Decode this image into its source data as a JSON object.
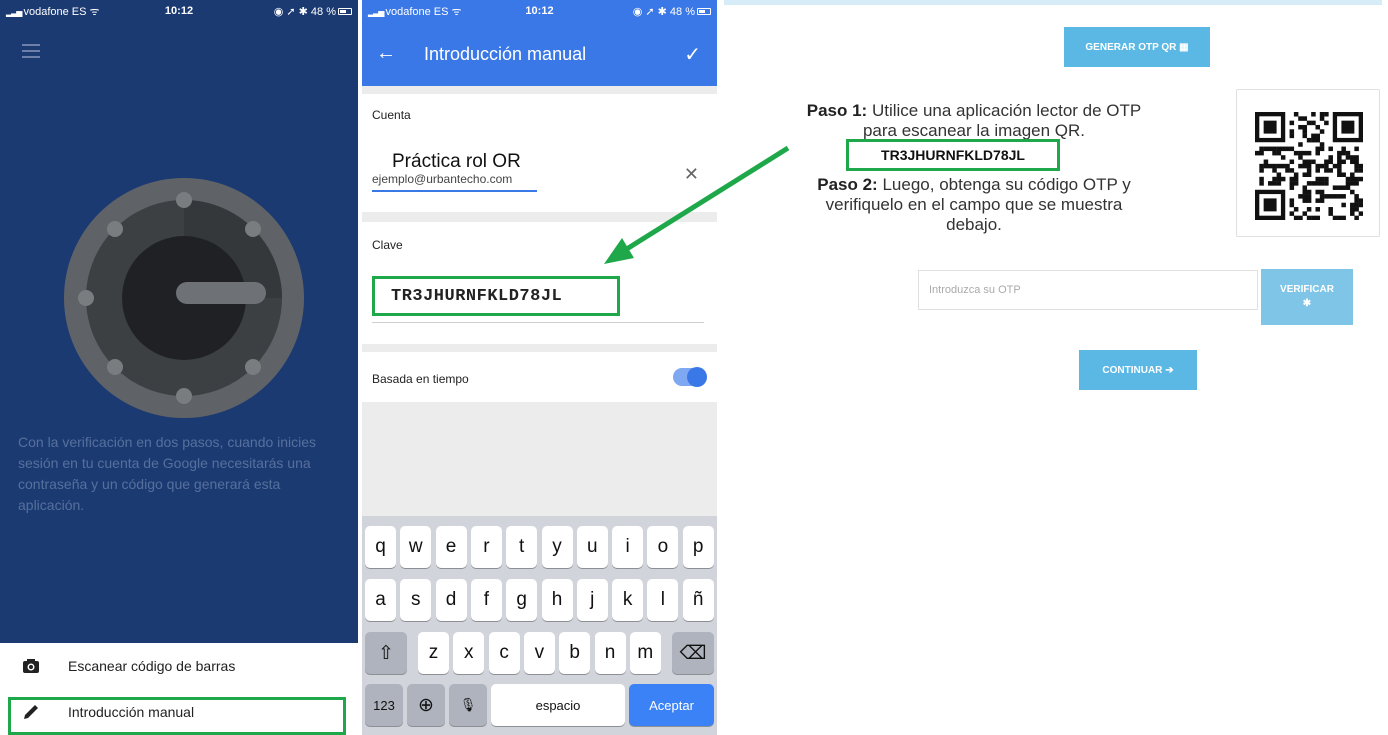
{
  "status_bar": {
    "carrier": "vodafone ES",
    "time": "10:12",
    "battery": "48 %"
  },
  "authenticator": {
    "description": "Con la verificación en dos pasos, cuando inicies sesión en tu cuenta de Google necesitarás una contraseña y un código que generará esta aplicación.",
    "menu": [
      {
        "label": "Escanear código de barras",
        "icon": "camera-icon"
      },
      {
        "label": "Introducción manual",
        "icon": "pencil-icon"
      }
    ]
  },
  "manual_entry": {
    "title": "Introducción manual",
    "account_label": "Cuenta",
    "account_value": "ejemplo@urbantecho.com",
    "account_overlay": "Práctica rol OR",
    "key_label": "Clave",
    "key_value": "TR3JHURNFKLD78JL",
    "time_based_label": "Basada en tiempo",
    "time_based_enabled": true
  },
  "keyboard": {
    "row1": [
      "q",
      "w",
      "e",
      "r",
      "t",
      "y",
      "u",
      "i",
      "o",
      "p"
    ],
    "row2": [
      "a",
      "s",
      "d",
      "f",
      "g",
      "h",
      "j",
      "k",
      "l",
      "ñ"
    ],
    "row3": [
      "z",
      "x",
      "c",
      "v",
      "b",
      "n",
      "m"
    ],
    "numbers_key": "123",
    "space_key": "espacio",
    "accept_key": "Aceptar"
  },
  "web_otp": {
    "generate_button": "GENERAR OTP QR",
    "step1_label": "Paso 1:",
    "step1_text": "Utilice una aplicación lector de OTP para escanear la imagen QR.",
    "code": "TR3JHURNFKLD78JL",
    "step2_label": "Paso 2:",
    "step2_text": "Luego, obtenga su código OTP y verifiquelo en el campo que se muestra debajo.",
    "otp_placeholder": "Introduzca su OTP",
    "verify_button": "VERIFICAR",
    "continue_button": "CONTINUAR"
  },
  "colors": {
    "auth_background": "#1c3a72",
    "app_bar": "#3b78e7",
    "highlight": "#1fa84a",
    "web_button": "#5bb8e4"
  }
}
